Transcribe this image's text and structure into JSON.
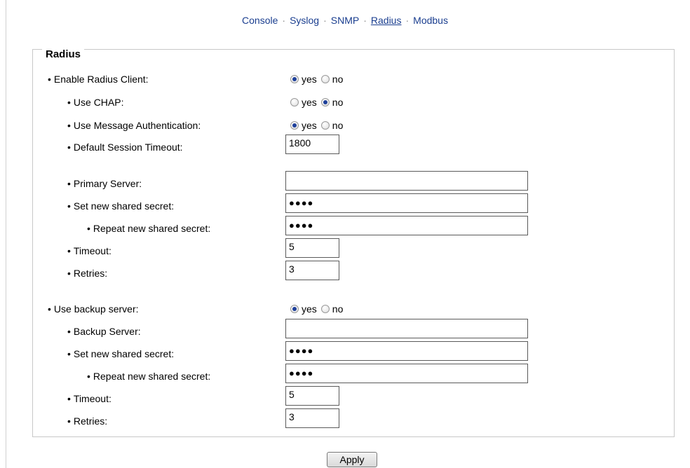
{
  "nav": {
    "console": "Console",
    "syslog": "Syslog",
    "snmp": "SNMP",
    "radius": "Radius",
    "modbus": "Modbus",
    "separator": "·"
  },
  "section_title": "Radius",
  "bullet": "•",
  "fields": {
    "enable_radius": {
      "label": "Enable Radius Client:",
      "selected": "yes"
    },
    "use_chap": {
      "label": "Use CHAP:",
      "selected": "no"
    },
    "use_msg_auth": {
      "label": "Use Message Authentication:",
      "selected": "yes"
    },
    "session_timeout": {
      "label": "Default Session Timeout:",
      "value": "1800"
    },
    "primary_server": {
      "label": "Primary Server:",
      "value": ""
    },
    "primary_secret": {
      "label": "Set new shared secret:",
      "value": "●●●●"
    },
    "primary_secret_repeat": {
      "label": "Repeat new shared secret:",
      "value": "●●●●"
    },
    "primary_timeout": {
      "label": "Timeout:",
      "value": "5"
    },
    "primary_retries": {
      "label": "Retries:",
      "value": "3"
    },
    "use_backup": {
      "label": "Use backup server:",
      "selected": "yes"
    },
    "backup_server": {
      "label": "Backup Server:",
      "value": ""
    },
    "backup_secret": {
      "label": "Set new shared secret:",
      "value": "●●●●"
    },
    "backup_secret_repeat": {
      "label": "Repeat new shared secret:",
      "value": "●●●●"
    },
    "backup_timeout": {
      "label": "Timeout:",
      "value": "5"
    },
    "backup_retries": {
      "label": "Retries:",
      "value": "3"
    }
  },
  "radio_labels": {
    "yes": "yes",
    "no": "no"
  },
  "apply_label": "Apply",
  "colors": {
    "link": "#1a3e8f",
    "radio_dot": "#1d3f9a",
    "border": "#c8c8c8"
  }
}
